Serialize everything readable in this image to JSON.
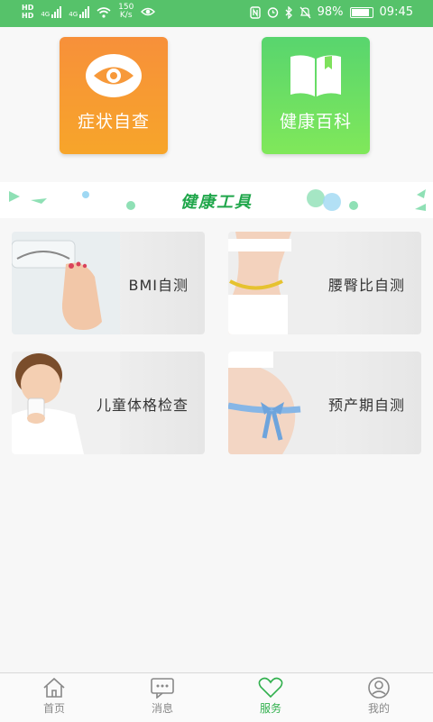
{
  "status_bar": {
    "hd1": "HD",
    "hd2": "HD",
    "net1": "4G",
    "net2": "4G",
    "speed_value": "150",
    "speed_unit": "K/s",
    "battery": "98%",
    "time": "09:45",
    "battery_level": 0.98
  },
  "top_cards": [
    {
      "label": "症状自查",
      "icon": "eye-icon",
      "color": "#f7993a"
    },
    {
      "label": "健康百科",
      "icon": "book-icon",
      "color": "#5ed96b"
    }
  ],
  "banner": {
    "title": "健康工具"
  },
  "tools": [
    {
      "label": "BMI自测",
      "icon": "scale-photo"
    },
    {
      "label": "腰臀比自测",
      "icon": "waist-photo"
    },
    {
      "label": "儿童体格检查",
      "icon": "child-photo"
    },
    {
      "label": "预产期自测",
      "icon": "pregnancy-photo"
    }
  ],
  "tabbar": {
    "items": [
      {
        "label": "首页",
        "icon": "home-icon"
      },
      {
        "label": "消息",
        "icon": "message-icon"
      },
      {
        "label": "服务",
        "icon": "heart-icon"
      },
      {
        "label": "我的",
        "icon": "profile-icon"
      }
    ],
    "active_index": 2,
    "active_color": "#31b04d"
  }
}
